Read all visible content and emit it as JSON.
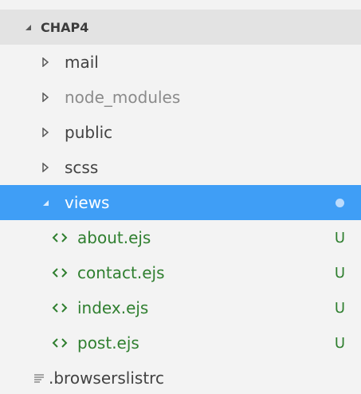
{
  "explorer": {
    "header": {
      "label": "CHAP4"
    },
    "items": [
      {
        "label": "mail"
      },
      {
        "label": "node_modules"
      },
      {
        "label": "public"
      },
      {
        "label": "scss"
      },
      {
        "label": "views"
      },
      {
        "label": "about.ejs",
        "status": "U"
      },
      {
        "label": "contact.ejs",
        "status": "U"
      },
      {
        "label": "index.ejs",
        "status": "U"
      },
      {
        "label": "post.ejs",
        "status": "U"
      },
      {
        "label": ".browserslistrc"
      }
    ]
  },
  "colors": {
    "selection": "#3f9ef6",
    "untracked_text": "#2f7f2f",
    "header_bg": "#e3e3e3"
  },
  "icons": {
    "expanded": "triangle-down-icon",
    "collapsed": "triangle-right-icon",
    "file": "code-brackets-icon",
    "config": "lines-icon"
  }
}
